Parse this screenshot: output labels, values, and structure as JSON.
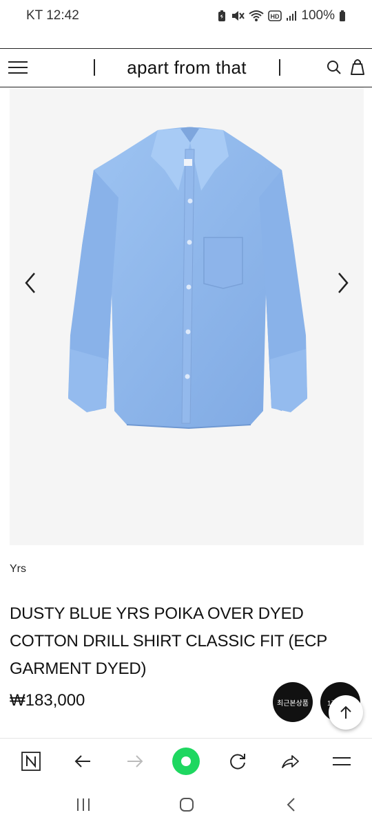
{
  "status_bar": {
    "carrier_time": "KT 12:42",
    "battery": "100%"
  },
  "header": {
    "brand": "apart from that"
  },
  "product": {
    "brand": "Yrs",
    "title": "DUSTY BLUE YRS POIKA OVER DYED COTTON DRILL SHIRT CLASSIC FIT (ECP GARMENT DYED)",
    "price": "₩183,000",
    "image_color": "#8fb8ec"
  },
  "floating": {
    "recent_label": "최근본상품",
    "compare_label": "1개"
  },
  "colors": {
    "accent_green": "#1ed760",
    "image_bg": "#f5f5f5"
  }
}
